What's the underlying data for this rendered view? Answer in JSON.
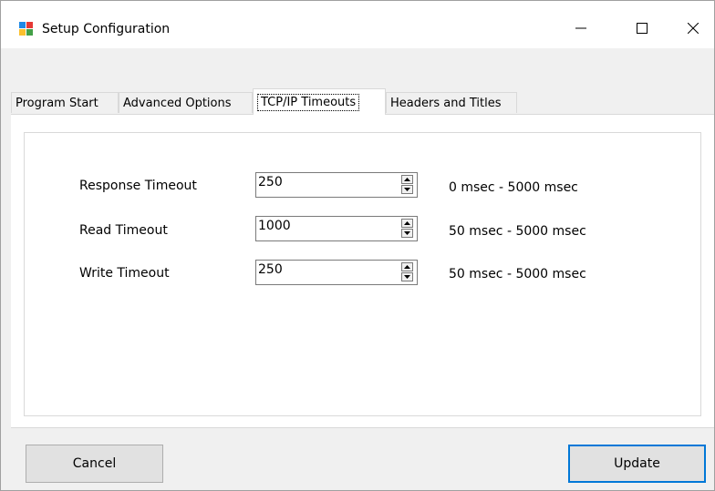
{
  "window": {
    "title": "Setup Configuration",
    "controls": {
      "minimize": "minimize-icon",
      "maximize": "maximize-icon",
      "close": "close-icon"
    }
  },
  "tabs": [
    {
      "label": "Program Start",
      "active": false
    },
    {
      "label": "Advanced Options",
      "active": false
    },
    {
      "label": "TCP/IP Timeouts",
      "active": true
    },
    {
      "label": "Headers and Titles",
      "active": false
    }
  ],
  "timeouts": [
    {
      "label": "Response Timeout",
      "value": "250",
      "range": "0 msec - 5000 msec"
    },
    {
      "label": "Read Timeout",
      "value": "1000",
      "range": "50 msec - 5000 msec"
    },
    {
      "label": "Write Timeout",
      "value": "250",
      "range": "50 msec -  5000 msec"
    }
  ],
  "buttons": {
    "cancel": "Cancel",
    "update": "Update"
  },
  "colors": {
    "accent": "#0078d7",
    "window_bg": "#f0f0f0",
    "panel_bg": "#ffffff"
  }
}
